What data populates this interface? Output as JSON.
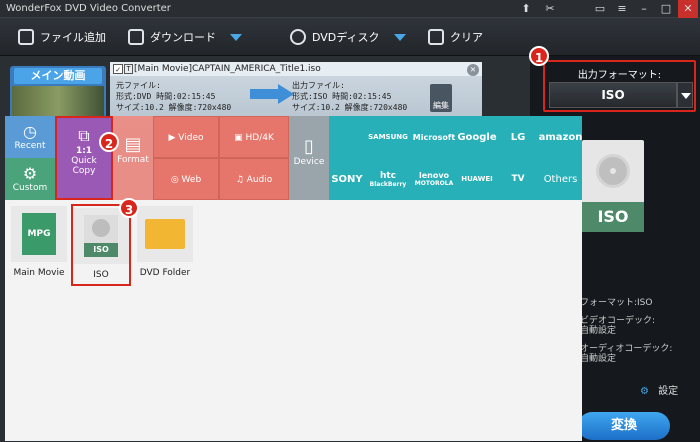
{
  "window": {
    "title": "WonderFox DVD Video Converter"
  },
  "toolbar": {
    "add_file": "ファイル追加",
    "download": "ダウンロード",
    "dvd_disc": "DVDディスク",
    "clear": "クリア"
  },
  "main_movie_badge": "メイン動画",
  "movie": {
    "title": "[Main Movie]CAPTAIN_AMERICA_Title1.iso",
    "source_label": "元ファイル:",
    "source_format": "形式:DVD",
    "source_time": "時間:02:15:45",
    "source_size": "サイズ:10.2",
    "source_res": "解像度:720x480",
    "output_label": "出力ファイル:",
    "output_format": "形式:ISO",
    "output_time": "時間:02:15:45",
    "output_size": "サイズ:10.2",
    "output_res": "解像度:720x480",
    "edit": "編集"
  },
  "output_format": {
    "label": "出力フォーマット:",
    "value": "ISO"
  },
  "categories": {
    "recent": "Recent",
    "custom": "Custom",
    "quick_copy_1": "1:1",
    "quick_copy_2": "Quick",
    "quick_copy_3": "Copy",
    "format": "Format",
    "video": "Video",
    "hd": "HD/4K",
    "web": "Web",
    "audio": "Audio",
    "device": "Device"
  },
  "brands": [
    "SAMSUNG",
    "Microsoft",
    "Google",
    "LG",
    "amazon",
    "SONY",
    "htc",
    "lenovo",
    "HUAWEI",
    "TV",
    "Others"
  ],
  "brand_subs": {
    "htc": "BlackBerry",
    "lenovo": "MOTOROLA"
  },
  "files": [
    {
      "label": "Main Movie",
      "tag": "MPG"
    },
    {
      "label": "ISO",
      "tag": "ISO"
    },
    {
      "label": "DVD Folder",
      "tag": ""
    }
  ],
  "right_panel": {
    "format_info": "フォーマット:ISO",
    "video_codec_label": "ビデオコーデック:",
    "video_codec": "自動設定",
    "audio_codec_label": "オーディオコーデック:",
    "audio_codec": "自動設定",
    "settings": "設定",
    "convert": "変換",
    "iso_tag": "ISO"
  },
  "step_numbers": [
    "1",
    "2",
    "3"
  ],
  "colors": {
    "recent": "#5a9bd6",
    "custom": "#4aa37a",
    "quick": "#9b59b6",
    "format": "#e6766b",
    "device": "#9aa4ab",
    "brands": "#27b0b8",
    "highlight": "#d9261c"
  }
}
